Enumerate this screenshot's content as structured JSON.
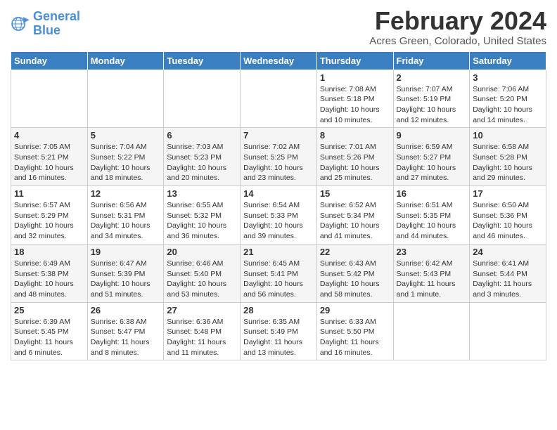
{
  "header": {
    "logo_general": "General",
    "logo_blue": "Blue",
    "month_title": "February 2024",
    "location": "Acres Green, Colorado, United States"
  },
  "weekdays": [
    "Sunday",
    "Monday",
    "Tuesday",
    "Wednesday",
    "Thursday",
    "Friday",
    "Saturday"
  ],
  "weeks": [
    [
      {
        "day": "",
        "info": ""
      },
      {
        "day": "",
        "info": ""
      },
      {
        "day": "",
        "info": ""
      },
      {
        "day": "",
        "info": ""
      },
      {
        "day": "1",
        "info": "Sunrise: 7:08 AM\nSunset: 5:18 PM\nDaylight: 10 hours\nand 10 minutes."
      },
      {
        "day": "2",
        "info": "Sunrise: 7:07 AM\nSunset: 5:19 PM\nDaylight: 10 hours\nand 12 minutes."
      },
      {
        "day": "3",
        "info": "Sunrise: 7:06 AM\nSunset: 5:20 PM\nDaylight: 10 hours\nand 14 minutes."
      }
    ],
    [
      {
        "day": "4",
        "info": "Sunrise: 7:05 AM\nSunset: 5:21 PM\nDaylight: 10 hours\nand 16 minutes."
      },
      {
        "day": "5",
        "info": "Sunrise: 7:04 AM\nSunset: 5:22 PM\nDaylight: 10 hours\nand 18 minutes."
      },
      {
        "day": "6",
        "info": "Sunrise: 7:03 AM\nSunset: 5:23 PM\nDaylight: 10 hours\nand 20 minutes."
      },
      {
        "day": "7",
        "info": "Sunrise: 7:02 AM\nSunset: 5:25 PM\nDaylight: 10 hours\nand 23 minutes."
      },
      {
        "day": "8",
        "info": "Sunrise: 7:01 AM\nSunset: 5:26 PM\nDaylight: 10 hours\nand 25 minutes."
      },
      {
        "day": "9",
        "info": "Sunrise: 6:59 AM\nSunset: 5:27 PM\nDaylight: 10 hours\nand 27 minutes."
      },
      {
        "day": "10",
        "info": "Sunrise: 6:58 AM\nSunset: 5:28 PM\nDaylight: 10 hours\nand 29 minutes."
      }
    ],
    [
      {
        "day": "11",
        "info": "Sunrise: 6:57 AM\nSunset: 5:29 PM\nDaylight: 10 hours\nand 32 minutes."
      },
      {
        "day": "12",
        "info": "Sunrise: 6:56 AM\nSunset: 5:31 PM\nDaylight: 10 hours\nand 34 minutes."
      },
      {
        "day": "13",
        "info": "Sunrise: 6:55 AM\nSunset: 5:32 PM\nDaylight: 10 hours\nand 36 minutes."
      },
      {
        "day": "14",
        "info": "Sunrise: 6:54 AM\nSunset: 5:33 PM\nDaylight: 10 hours\nand 39 minutes."
      },
      {
        "day": "15",
        "info": "Sunrise: 6:52 AM\nSunset: 5:34 PM\nDaylight: 10 hours\nand 41 minutes."
      },
      {
        "day": "16",
        "info": "Sunrise: 6:51 AM\nSunset: 5:35 PM\nDaylight: 10 hours\nand 44 minutes."
      },
      {
        "day": "17",
        "info": "Sunrise: 6:50 AM\nSunset: 5:36 PM\nDaylight: 10 hours\nand 46 minutes."
      }
    ],
    [
      {
        "day": "18",
        "info": "Sunrise: 6:49 AM\nSunset: 5:38 PM\nDaylight: 10 hours\nand 48 minutes."
      },
      {
        "day": "19",
        "info": "Sunrise: 6:47 AM\nSunset: 5:39 PM\nDaylight: 10 hours\nand 51 minutes."
      },
      {
        "day": "20",
        "info": "Sunrise: 6:46 AM\nSunset: 5:40 PM\nDaylight: 10 hours\nand 53 minutes."
      },
      {
        "day": "21",
        "info": "Sunrise: 6:45 AM\nSunset: 5:41 PM\nDaylight: 10 hours\nand 56 minutes."
      },
      {
        "day": "22",
        "info": "Sunrise: 6:43 AM\nSunset: 5:42 PM\nDaylight: 10 hours\nand 58 minutes."
      },
      {
        "day": "23",
        "info": "Sunrise: 6:42 AM\nSunset: 5:43 PM\nDaylight: 11 hours\nand 1 minute."
      },
      {
        "day": "24",
        "info": "Sunrise: 6:41 AM\nSunset: 5:44 PM\nDaylight: 11 hours\nand 3 minutes."
      }
    ],
    [
      {
        "day": "25",
        "info": "Sunrise: 6:39 AM\nSunset: 5:45 PM\nDaylight: 11 hours\nand 6 minutes."
      },
      {
        "day": "26",
        "info": "Sunrise: 6:38 AM\nSunset: 5:47 PM\nDaylight: 11 hours\nand 8 minutes."
      },
      {
        "day": "27",
        "info": "Sunrise: 6:36 AM\nSunset: 5:48 PM\nDaylight: 11 hours\nand 11 minutes."
      },
      {
        "day": "28",
        "info": "Sunrise: 6:35 AM\nSunset: 5:49 PM\nDaylight: 11 hours\nand 13 minutes."
      },
      {
        "day": "29",
        "info": "Sunrise: 6:33 AM\nSunset: 5:50 PM\nDaylight: 11 hours\nand 16 minutes."
      },
      {
        "day": "",
        "info": ""
      },
      {
        "day": "",
        "info": ""
      }
    ]
  ]
}
